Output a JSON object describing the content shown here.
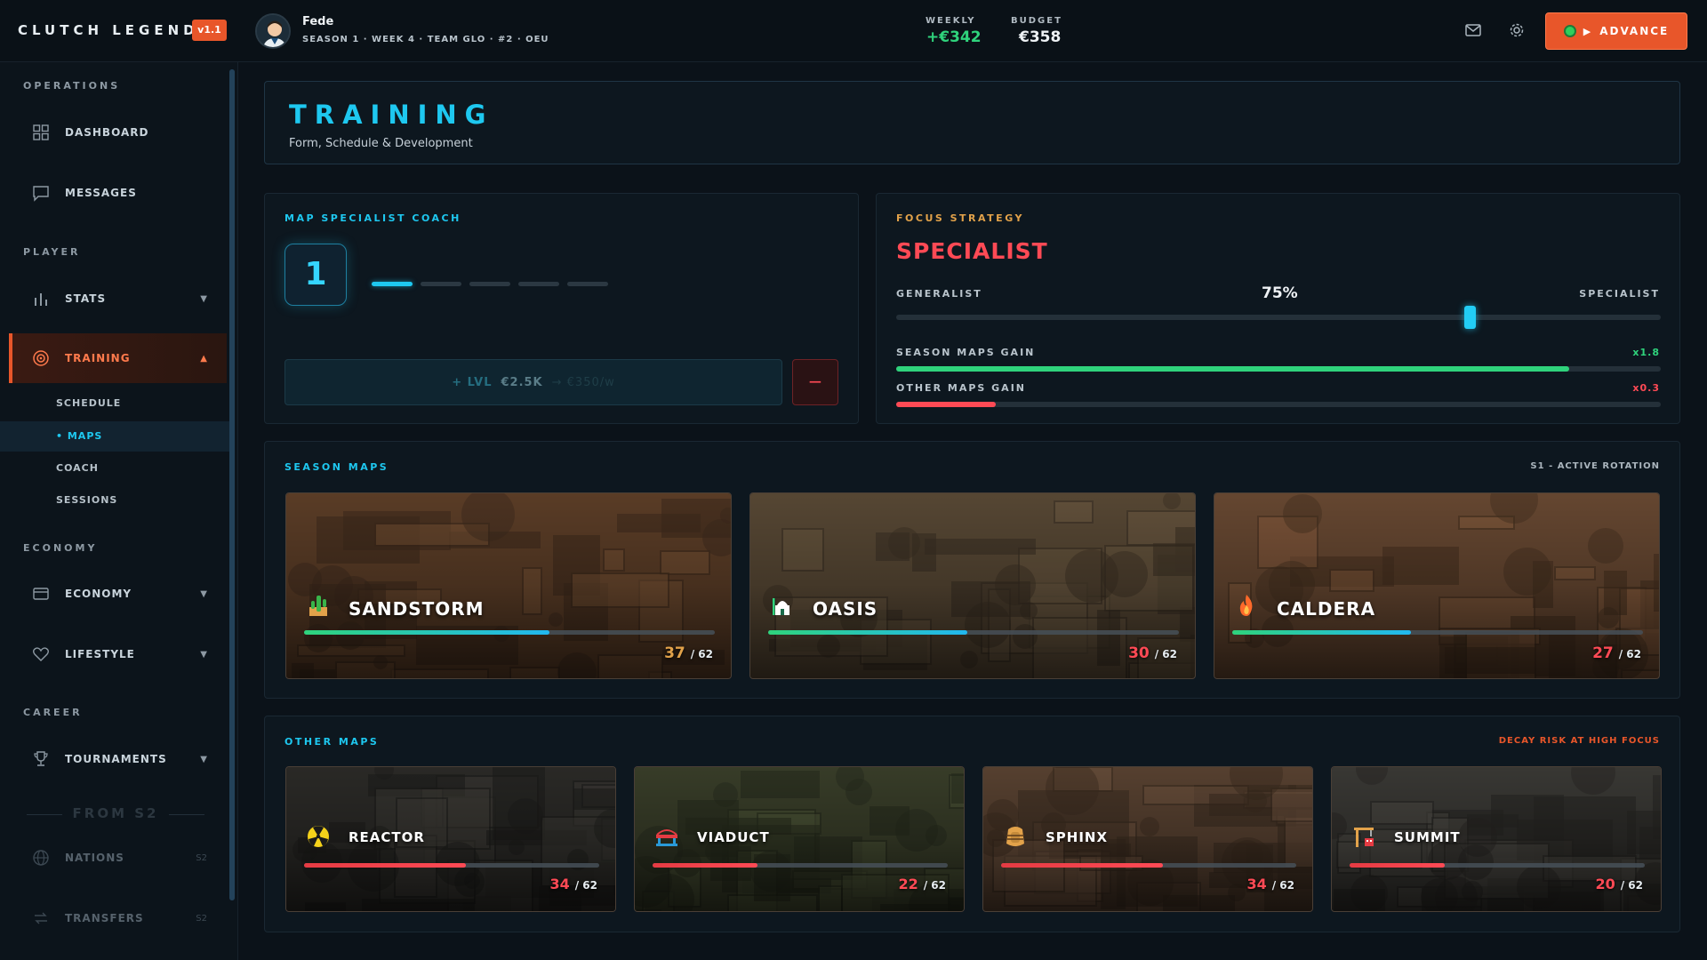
{
  "app": {
    "brand": "CLUTCH LEGEND",
    "version": "v1.1"
  },
  "player": {
    "name": "Fede",
    "meta": "SEASON 1 · WEEK 4 · TEAM GLO · #2 · OEU"
  },
  "finance": {
    "weekly_label": "WEEKLY",
    "weekly_value": "+€342",
    "budget_label": "BUDGET",
    "budget_value": "€358"
  },
  "actions": {
    "advance_label": "ADVANCE"
  },
  "sidebar": {
    "sections": {
      "operations": "OPERATIONS",
      "player": "PLAYER",
      "economy": "ECONOMY",
      "career": "CAREER"
    },
    "items": {
      "dashboard": "DASHBOARD",
      "messages": "MESSAGES",
      "stats": "STATS",
      "training": "TRAINING",
      "economy": "ECONOMY",
      "lifestyle": "LIFESTYLE",
      "tournaments": "TOURNAMENTS",
      "nations": "NATIONS",
      "transfers": "TRANSFERS"
    },
    "training_sub": {
      "schedule": "SCHEDULE",
      "maps": "• MAPS",
      "coach": "COACH",
      "sessions": "SESSIONS"
    },
    "locked_label": "FROM S2",
    "locked_badge": "S2"
  },
  "page": {
    "title": "TRAINING",
    "subtitle": "Form, Schedule & Development"
  },
  "coach": {
    "label": "MAP SPECIALIST COACH",
    "level": "1",
    "level_max": 5,
    "upgrade_prefix": "+ LVL",
    "upgrade_cost": "€2.5K",
    "upgrade_weekly": "→ €350/w"
  },
  "focus": {
    "label": "FOCUS STRATEGY",
    "strategy": "SPECIALIST",
    "left_label": "GENERALIST",
    "right_label": "SPECIALIST",
    "percent_label": "75%",
    "percent": 75,
    "season_gain_label": "SEASON MAPS GAIN",
    "season_gain_mult": "x1.8",
    "season_gain_fill": 0.88,
    "other_gain_label": "OTHER MAPS GAIN",
    "other_gain_mult": "x0.3",
    "other_gain_fill": 0.13
  },
  "season_maps": {
    "label": "SEASON MAPS",
    "note": "S1 - ACTIVE ROTATION",
    "cards": [
      {
        "name": "SANDSTORM",
        "score": "37",
        "max": "/ 62",
        "value": 37,
        "total": 62
      },
      {
        "name": "OASIS",
        "score": "30",
        "max": "/ 62",
        "value": 30,
        "total": 62
      },
      {
        "name": "CALDERA",
        "score": "27",
        "max": "/ 62",
        "value": 27,
        "total": 62
      }
    ]
  },
  "other_maps": {
    "label": "OTHER MAPS",
    "note": "DECAY RISK AT HIGH FOCUS",
    "cards": [
      {
        "name": "REACTOR",
        "score": "34",
        "max": "/ 62",
        "value": 34,
        "total": 62
      },
      {
        "name": "VIADUCT",
        "score": "22",
        "max": "/ 62",
        "value": 22,
        "total": 62
      },
      {
        "name": "SPHINX",
        "score": "34",
        "max": "/ 62",
        "value": 34,
        "total": 62
      },
      {
        "name": "SUMMIT",
        "score": "20",
        "max": "/ 62",
        "value": 20,
        "total": 62
      }
    ]
  },
  "colors": {
    "accent": "#1ec8f0",
    "orange": "#e8562a",
    "red": "#ff4a55",
    "green": "#2fd37c",
    "gold": "#e2a24a",
    "season_fill": "#22b8d8",
    "other_fill": "#e53b43"
  },
  "icons": {
    "dashboard": "grid-icon",
    "messages": "chat-icon",
    "stats": "bars-icon",
    "training": "target-icon",
    "economy": "wallet-icon",
    "lifestyle": "heart-icon",
    "tournaments": "trophy-icon",
    "nations": "globe-icon",
    "transfers": "transfer-icon",
    "sandstorm": "cactus-icon",
    "oasis": "mosque-icon",
    "caldera": "fire-icon",
    "reactor": "radiation-icon",
    "viaduct": "bridge-icon",
    "sphinx": "pharaoh-icon",
    "summit": "crane-icon"
  }
}
